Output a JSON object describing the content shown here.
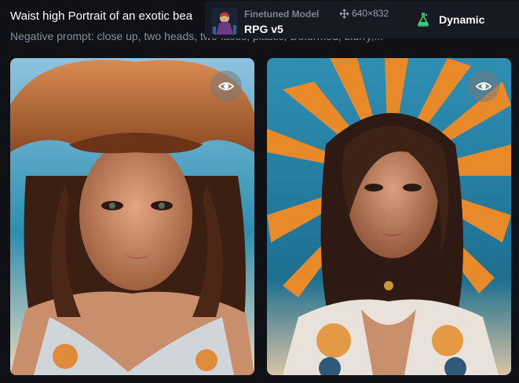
{
  "prompt": {
    "title": "Waist high Portrait of an exotic bea",
    "negative": "Negative prompt: close up, two heads, two faces, plastic, Deformed, blurry,..."
  },
  "model": {
    "label": "Finetuned Model",
    "name": "RPG v5",
    "dimensions": "640×832",
    "mode": "Dynamic"
  },
  "images": [
    {
      "alt": "Portrait of woman in an orange straw hat on a beach",
      "action_icon": "eye-icon"
    },
    {
      "alt": "Portrait of woman with an orange feather headdress in a white embroidered blouse",
      "action_icon": "eye-icon"
    }
  ],
  "colors": {
    "background": "#0f1117",
    "panel": "#171a22",
    "muted_text": "#8a8f9c",
    "accent_flask": "#3dd27a"
  }
}
